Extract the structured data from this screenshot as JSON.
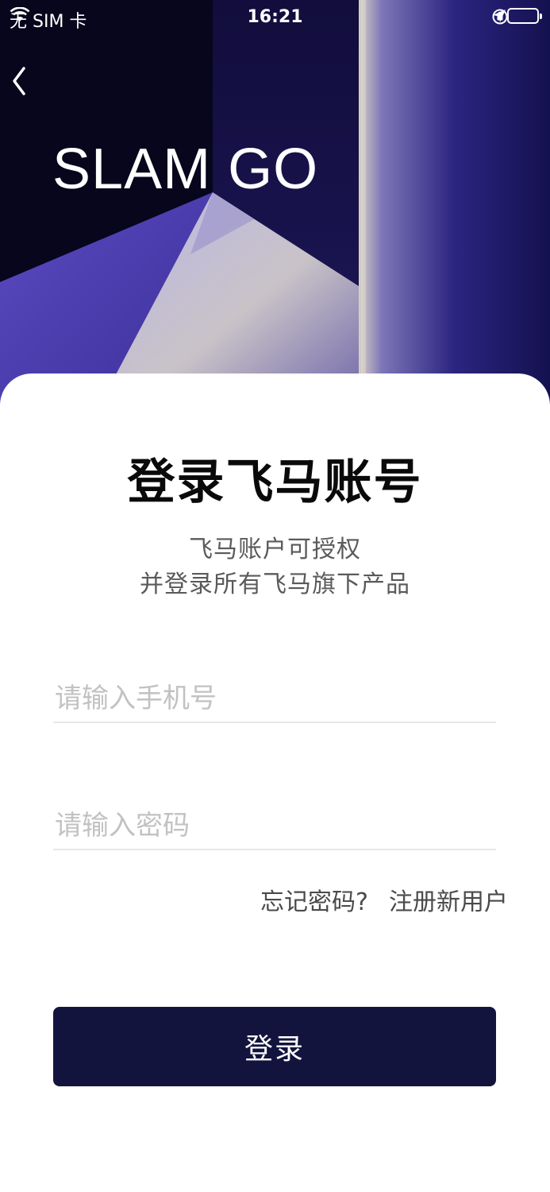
{
  "status_bar": {
    "carrier": "无 SIM 卡",
    "time": "16:21",
    "wifi_icon": "wifi-icon",
    "orientation_lock_icon": "orientation-lock-icon",
    "location_icon": "location-arrow-icon",
    "battery_icon": "battery-icon"
  },
  "header": {
    "back_icon": "chevron-left-icon",
    "brand": "SLAM GO"
  },
  "login": {
    "title": "登录飞马账号",
    "subtitle_line1": "飞马账户可授权",
    "subtitle_line2": "并登录所有飞马旗下产品",
    "phone_placeholder": "请输入手机号",
    "phone_value": "",
    "password_placeholder": "请输入密码",
    "password_value": "",
    "forgot_password": "忘记密码?",
    "register": "注册新用户",
    "submit_label": "登录"
  },
  "colors": {
    "hero_dark": "#0d0a2c",
    "hero_purple": "#3a2f9a",
    "button_bg": "#13143e",
    "placeholder": "#c2c2c2",
    "divider": "#e7e7e7"
  }
}
